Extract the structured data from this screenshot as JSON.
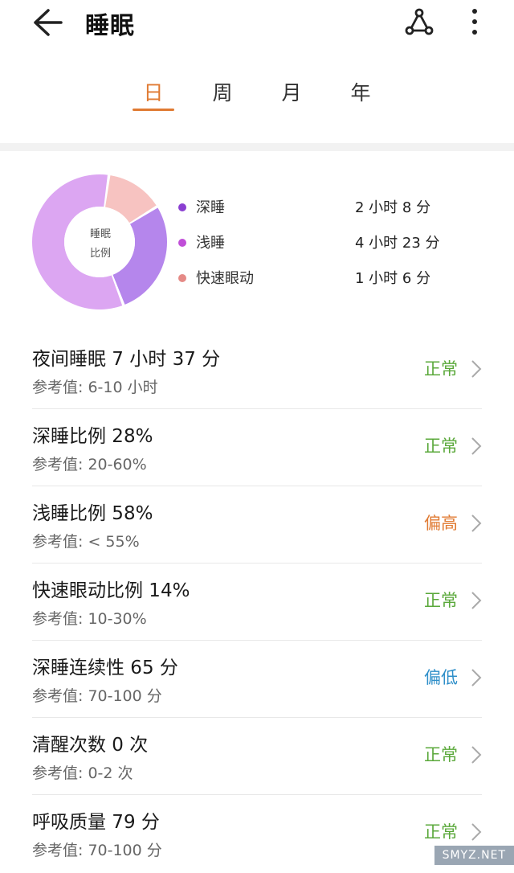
{
  "header": {
    "title": "睡眠"
  },
  "tabs": [
    {
      "label": "日",
      "active": true
    },
    {
      "label": "周",
      "active": false
    },
    {
      "label": "月",
      "active": false
    },
    {
      "label": "年",
      "active": false
    }
  ],
  "chart_data": {
    "type": "pie",
    "title": "睡眠比例",
    "labels": [
      "深睡",
      "浅睡",
      "快速眼动"
    ],
    "values": [
      28,
      58,
      14
    ],
    "colors": [
      "#b586ec",
      "#dca6f2",
      "#f7c3c1"
    ]
  },
  "legend": [
    {
      "name": "深睡",
      "value": "2 小时 8 分",
      "color": "#8a3fd1"
    },
    {
      "name": "浅睡",
      "value": "4 小时 23 分",
      "color": "#c04ed8"
    },
    {
      "name": "快速眼动",
      "value": "1 小时 6 分",
      "color": "#e58a86"
    }
  ],
  "metrics": [
    {
      "title": "夜间睡眠  7 小时 37 分",
      "ref": "参考值: 6-10 小时",
      "status": "正常",
      "status_color": "#5aa83a"
    },
    {
      "title": "深睡比例  28%",
      "ref": "参考值: 20-60%",
      "status": "正常",
      "status_color": "#5aa83a"
    },
    {
      "title": "浅睡比例  58%",
      "ref": "参考值: < 55%",
      "status": "偏高",
      "status_color": "#e07a32"
    },
    {
      "title": "快速眼动比例  14%",
      "ref": "参考值: 10-30%",
      "status": "正常",
      "status_color": "#5aa83a"
    },
    {
      "title": "深睡连续性  65 分",
      "ref": "参考值: 70-100 分",
      "status": "偏低",
      "status_color": "#2f8fc9"
    },
    {
      "title": "清醒次数  0 次",
      "ref": "参考值: 0-2 次",
      "status": "正常",
      "status_color": "#5aa83a"
    },
    {
      "title": "呼吸质量  79 分",
      "ref": "参考值: 70-100 分",
      "status": "正常",
      "status_color": "#5aa83a"
    }
  ],
  "watermark": "SMYZ.NET"
}
